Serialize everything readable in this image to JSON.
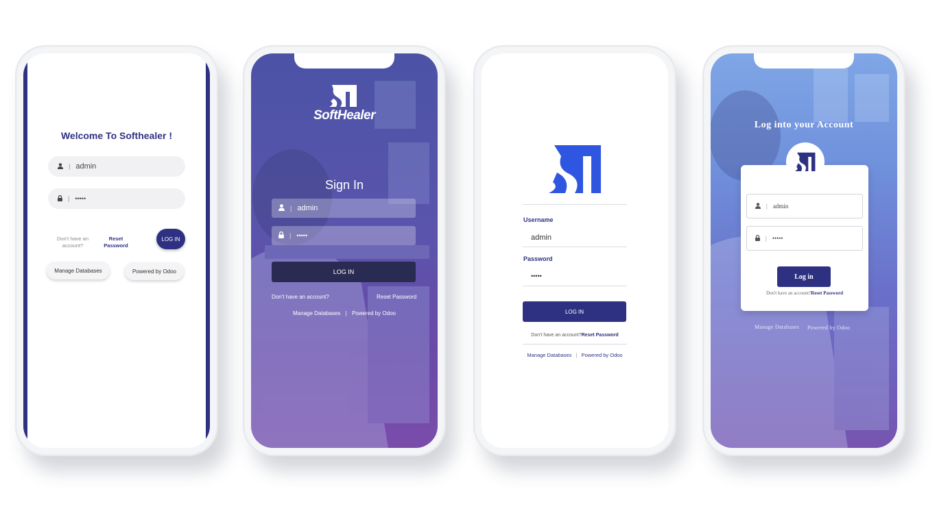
{
  "colors": {
    "navy": "#2e3182",
    "brand_blue": "#2f56e0",
    "white": "#ffffff"
  },
  "phone1": {
    "title": "Welcome To Softhealer !",
    "username_value": "admin",
    "password_value": "•••••",
    "no_account_text": "Don't have an account?",
    "reset_password_label": "Reset Password",
    "login_label": "LOG IN",
    "manage_databases_label": "Manage Databases",
    "powered_by_label": "Powered by Odoo",
    "icons": [
      "user-icon",
      "lock-icon"
    ]
  },
  "phone2": {
    "logo_text": "SoftHealer",
    "title": "Sign In",
    "username_value": "admin",
    "password_value": "•••••",
    "login_label": "LOG IN",
    "no_account_text": "Don't have an account?",
    "reset_password_label": "Reset Password",
    "manage_databases_label": "Manage Databases",
    "separator": "|",
    "powered_by_label": "Powered by Odoo"
  },
  "phone3": {
    "username_label": "Username",
    "username_value": "admin",
    "password_label": "Password",
    "password_value": "•••••",
    "login_label": "LOG IN",
    "no_account_text": "Don't have an account?",
    "reset_password_label": "Reset Password",
    "manage_databases_label": "Manage Databases",
    "separator": "|",
    "powered_by_label": "Powered by Odoo"
  },
  "phone4": {
    "title": "Log into your Account",
    "username_value": "admin",
    "password_value": "•••••",
    "login_label": "Log in",
    "no_account_text": "Don't have an account?",
    "reset_password_label": "Reset Password",
    "manage_databases_label": "Manage Databases",
    "powered_by_label": "Powered by Odoo"
  }
}
